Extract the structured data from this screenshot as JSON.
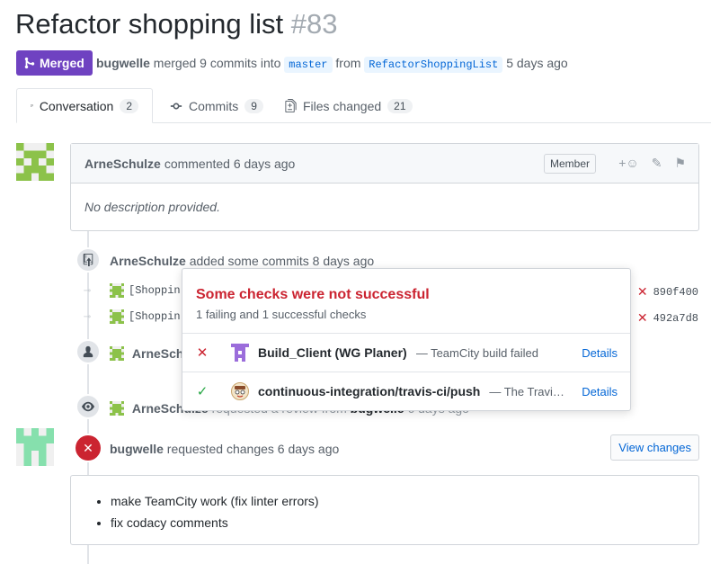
{
  "header": {
    "title": "Refactor shopping list",
    "number": "#83",
    "state": "Merged",
    "author": "bugwelle",
    "merged_text": "merged 9 commits into",
    "base_branch": "master",
    "from_text": "from",
    "head_branch": "RefactorShoppingList",
    "time": "5 days ago"
  },
  "tabs": [
    {
      "label": "Conversation",
      "count": "2",
      "icon": "conversation-icon"
    },
    {
      "label": "Commits",
      "count": "9",
      "icon": "commit-icon"
    },
    {
      "label": "Files changed",
      "count": "21",
      "icon": "file-diff-icon"
    }
  ],
  "comment": {
    "author": "ArneSchulze",
    "action": "commented 6 days ago",
    "badge": "Member",
    "body": "No description provided."
  },
  "commits_event": {
    "author": "ArneSchulze",
    "action": "added some commits 8 days ago",
    "commits": [
      {
        "message": "[Shoppin",
        "sha": "890f400"
      },
      {
        "message": "[Shoppin",
        "sha": "492a7d8"
      }
    ]
  },
  "assign_event": {
    "author": "ArneSchu"
  },
  "review_request_event": {
    "author": "ArneSchulze",
    "action": "requested a review from",
    "target": "bugwelle",
    "time": "6 days ago"
  },
  "review": {
    "author": "bugwelle",
    "action": "requested changes 6 days ago",
    "button": "View changes",
    "items": [
      "make TeamCity work (fix linter errors)",
      "fix codacy comments"
    ]
  },
  "popover": {
    "title": "Some checks were not successful",
    "subtitle": "1 failing and 1 successful checks",
    "checks": [
      {
        "status": "failure",
        "name": "Build_Client (WG Planer)",
        "description": "— TeamCity build failed",
        "link": "Details"
      },
      {
        "status": "success",
        "name": "continuous-integration/travis-ci/push",
        "description": "— The Travis C...",
        "link": "Details"
      }
    ]
  },
  "colors": {
    "merged": "#6f42c1",
    "fail": "#cb2431",
    "success": "#28a745",
    "link": "#0366d6"
  }
}
